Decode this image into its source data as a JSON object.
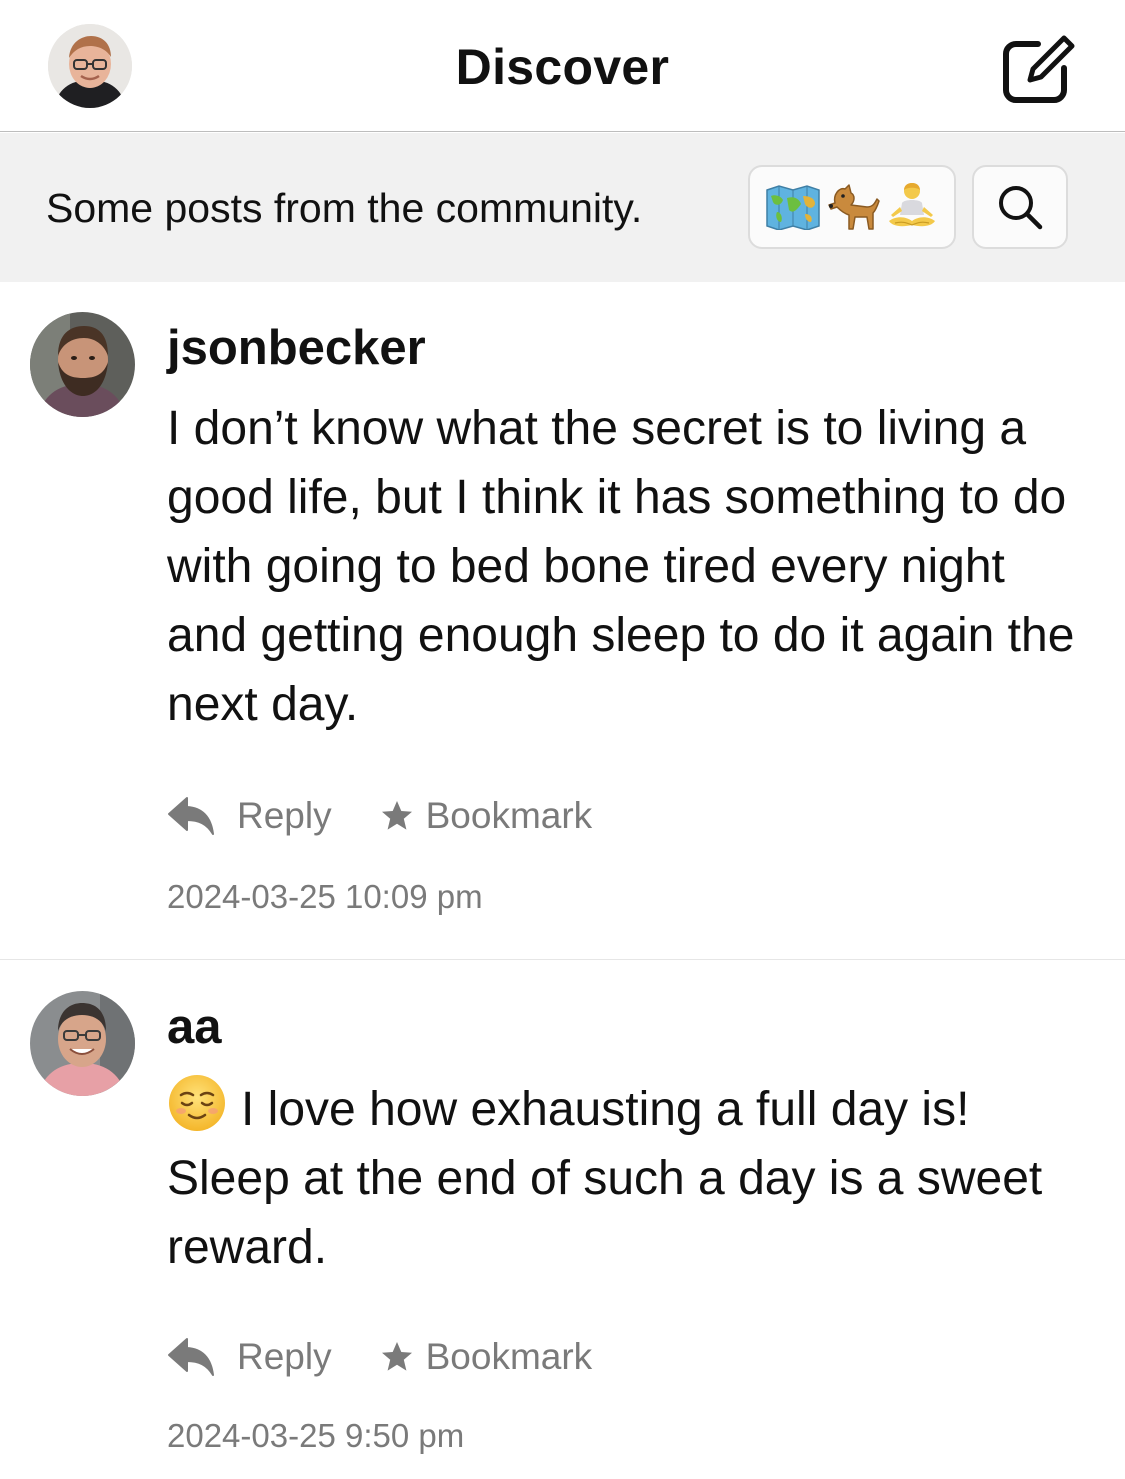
{
  "nav": {
    "title": "Discover",
    "avatar_icon": "user-avatar",
    "compose_icon": "compose-icon"
  },
  "header": {
    "description": "Some posts from the community.",
    "topics_icons": [
      "world-map-emoji",
      "dog-emoji",
      "meditation-emoji"
    ],
    "search_icon": "search-icon"
  },
  "posts": [
    {
      "username": "jsonbecker",
      "text": "I don’t know what the secret is to living a good life, but I think it has something to do with going to bed bone tired every night and getting enough sleep to do it again the next day.",
      "reply_label": "Reply",
      "bookmark_label": "Bookmark",
      "timestamp": "2024-03-25 10:09 pm"
    },
    {
      "username": "aa",
      "lead_emoji": "relieved-face-emoji",
      "text": "I love how exhausting a full day is! Sleep at the end of such a day is a sweet reward.",
      "reply_label": "Reply",
      "bookmark_label": "Bookmark",
      "timestamp": "2024-03-25 9:50 pm"
    }
  ],
  "colors": {
    "strip_background": "#f1f1f1",
    "secondary_text": "#7a7a7a",
    "primary_text": "#111111"
  }
}
